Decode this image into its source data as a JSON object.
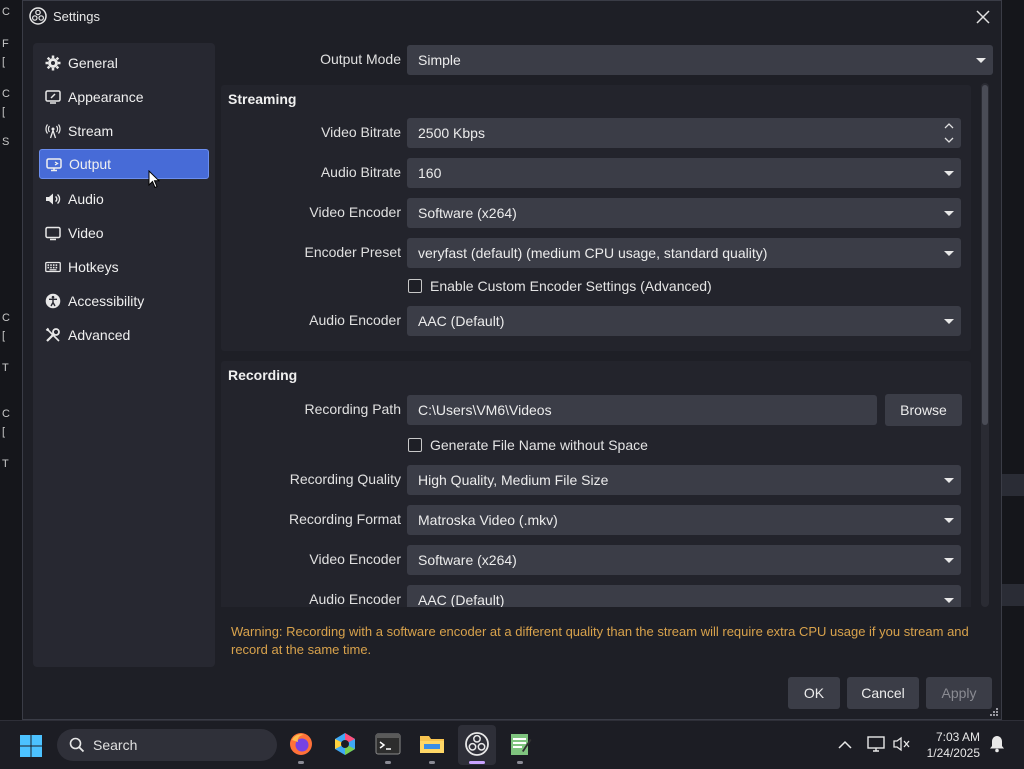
{
  "window": {
    "title": "Settings"
  },
  "sidebar": {
    "items": [
      {
        "label": "General",
        "icon": "gear-icon"
      },
      {
        "label": "Appearance",
        "icon": "appearance-icon"
      },
      {
        "label": "Stream",
        "icon": "antenna-icon"
      },
      {
        "label": "Output",
        "icon": "output-icon",
        "active": true
      },
      {
        "label": "Audio",
        "icon": "speaker-icon"
      },
      {
        "label": "Video",
        "icon": "monitor-icon"
      },
      {
        "label": "Hotkeys",
        "icon": "keyboard-icon"
      },
      {
        "label": "Accessibility",
        "icon": "accessibility-icon"
      },
      {
        "label": "Advanced",
        "icon": "tools-icon"
      }
    ]
  },
  "output_mode": {
    "label": "Output Mode",
    "value": "Simple"
  },
  "streaming": {
    "title": "Streaming",
    "video_bitrate": {
      "label": "Video Bitrate",
      "value": "2500 Kbps"
    },
    "audio_bitrate": {
      "label": "Audio Bitrate",
      "value": "160"
    },
    "video_encoder": {
      "label": "Video Encoder",
      "value": "Software (x264)"
    },
    "encoder_preset": {
      "label": "Encoder Preset",
      "value": "veryfast (default) (medium CPU usage, standard quality)"
    },
    "custom_settings": {
      "label": "Enable Custom Encoder Settings (Advanced)",
      "checked": false
    },
    "audio_encoder": {
      "label": "Audio Encoder",
      "value": "AAC (Default)"
    }
  },
  "recording": {
    "title": "Recording",
    "path": {
      "label": "Recording Path",
      "value": "C:\\Users\\VM6\\Videos"
    },
    "browse_label": "Browse",
    "no_space": {
      "label": "Generate File Name without Space",
      "checked": false
    },
    "quality": {
      "label": "Recording Quality",
      "value": "High Quality, Medium File Size"
    },
    "format": {
      "label": "Recording Format",
      "value": "Matroska Video (.mkv)"
    },
    "video_encoder": {
      "label": "Video Encoder",
      "value": "Software (x264)"
    },
    "audio_encoder": {
      "label": "Audio Encoder",
      "value": "AAC (Default)"
    }
  },
  "warning": "Warning: Recording with a software encoder at a different quality than the stream will require extra CPU usage if you stream and record at the same time.",
  "buttons": {
    "ok": "OK",
    "cancel": "Cancel",
    "apply": "Apply"
  },
  "taskbar": {
    "search_label": "Search",
    "time": "7:03 AM",
    "date": "1/24/2025"
  },
  "colors": {
    "accent": "#476bd7",
    "warning": "#d8a24c",
    "panel": "#23242c"
  }
}
